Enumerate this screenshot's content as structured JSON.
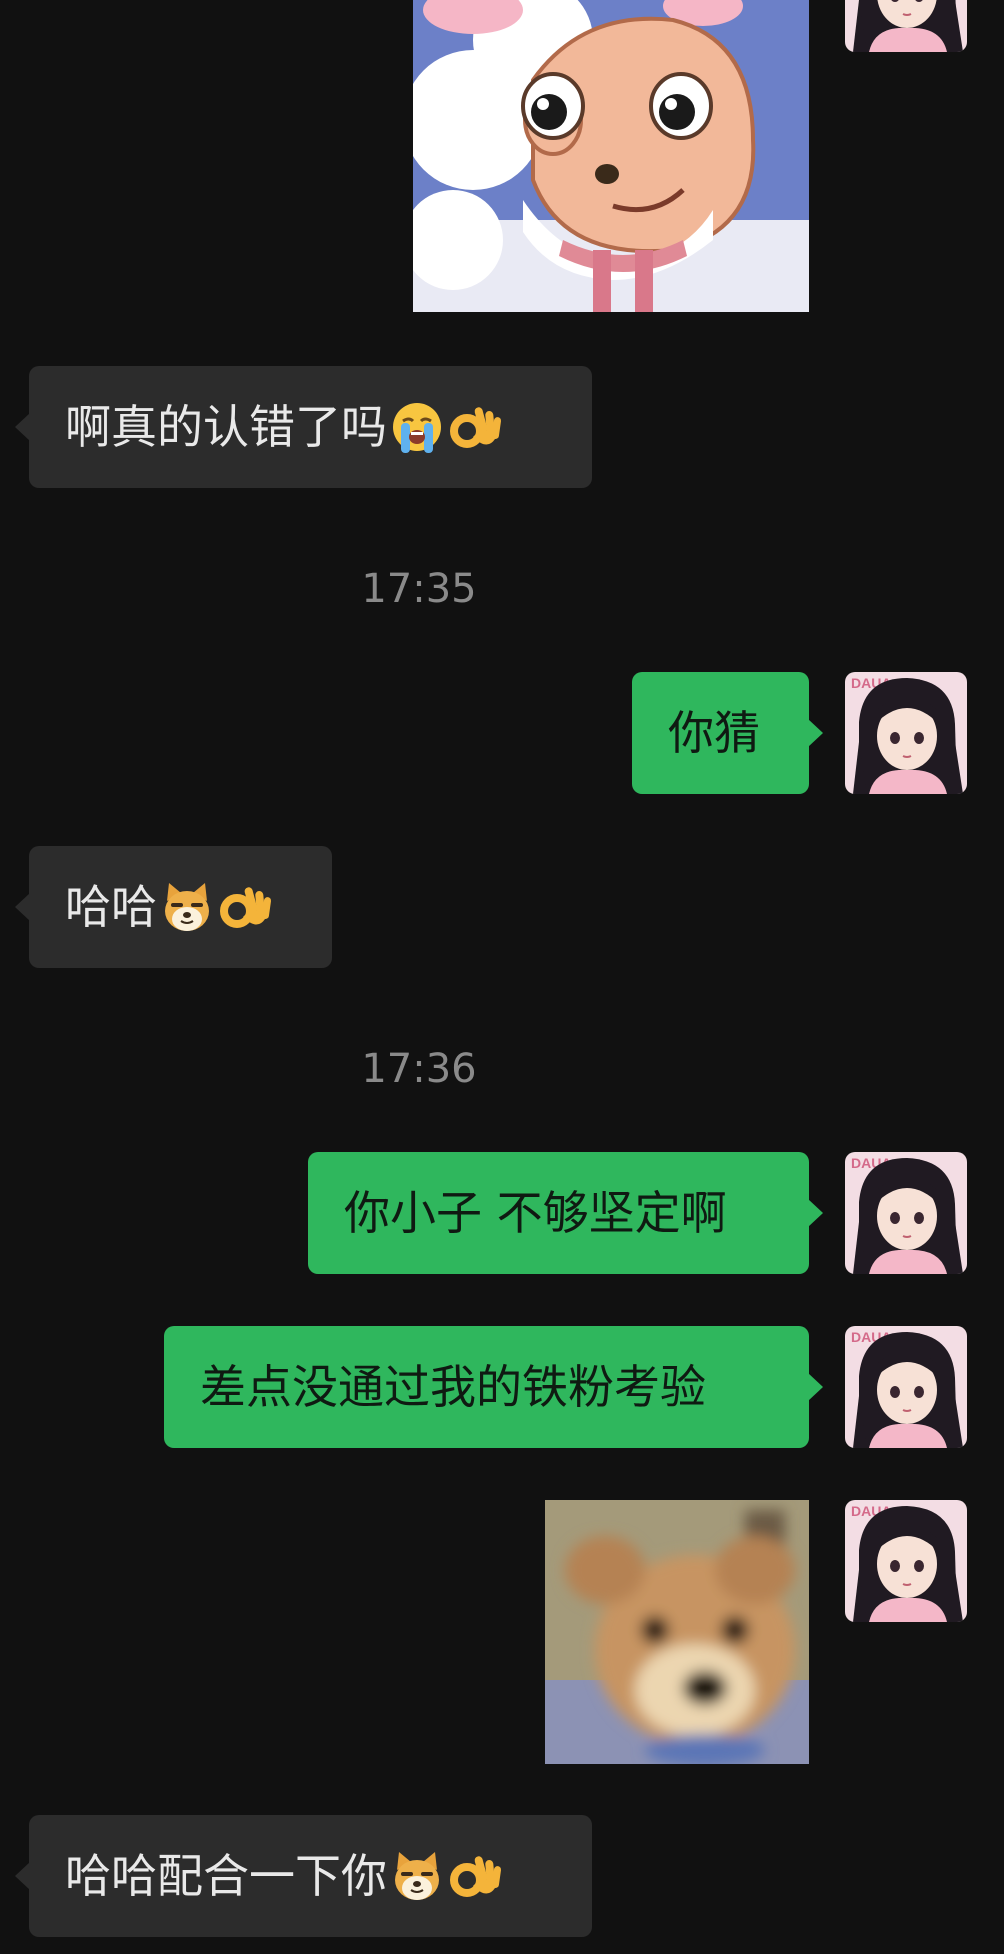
{
  "messages": {
    "m1": {
      "text": "啊真的认错了吗"
    },
    "t1": {
      "time": "17:35"
    },
    "m2": {
      "text": "你猜"
    },
    "m3": {
      "text": "哈哈"
    },
    "t2": {
      "time": "17:36"
    },
    "m4": {
      "text": "你小子 不够坚定啊"
    },
    "m5": {
      "text": "差点没通过我的铁粉考验"
    },
    "m6": {
      "text": "哈哈配合一下你"
    }
  },
  "icons": {
    "crying": "loudly-crying-face-emoji",
    "ok": "ok-hand-emoji",
    "doge": "doge-emoji",
    "sticker_top": "cartoon-sheep-sticker",
    "sticker_dog": "blurry-dog-sticker",
    "avatar": "anime-girl-avatar"
  },
  "colors": {
    "background": "#111111",
    "incoming_bubble": "#2c2c2c",
    "outgoing_bubble": "#2fb75d",
    "timestamp": "#8a8a8a"
  }
}
